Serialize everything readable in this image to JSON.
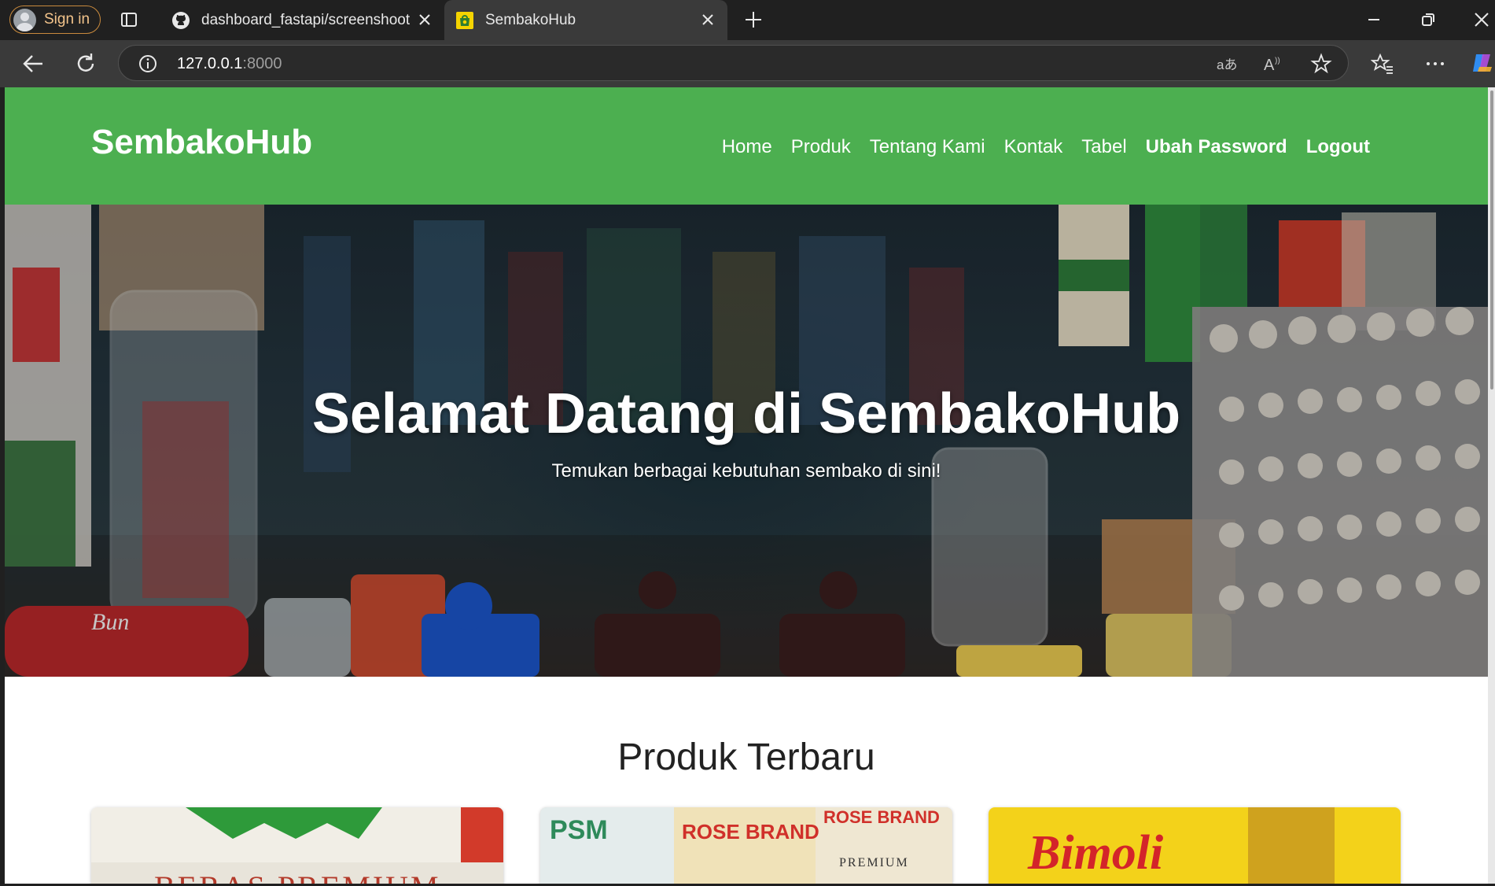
{
  "browser": {
    "signin_label": "Sign in",
    "tabs": [
      {
        "title": "dashboard_fastapi/screenshoots/d",
        "icon": "github-icon",
        "active": false
      },
      {
        "title": "SembakoHub",
        "icon": "sembakohub-favicon",
        "active": true
      }
    ],
    "url_host": "127.0.0.1",
    "url_port": ":8000"
  },
  "site": {
    "brand": "SembakoHub",
    "nav": [
      "Home",
      "Produk",
      "Tentang Kami",
      "Kontak",
      "Tabel"
    ],
    "nav_bold": [
      "Ubah Password",
      "Logout"
    ],
    "hero_title": "Selamat Datang di SembakoHub",
    "hero_subtitle": "Temukan berbagai kebutuhan sembako di sini!",
    "section_title": "Produk Terbaru",
    "product_cards": [
      {
        "image_text": "BERAS PREMIUM"
      },
      {
        "image_text": "ROSE BRAND"
      },
      {
        "image_text": "Bimoli"
      }
    ]
  },
  "colors": {
    "navbar": "#4caf50",
    "chrome_bg": "#202020",
    "toolbar_bg": "#3a3a3a"
  }
}
